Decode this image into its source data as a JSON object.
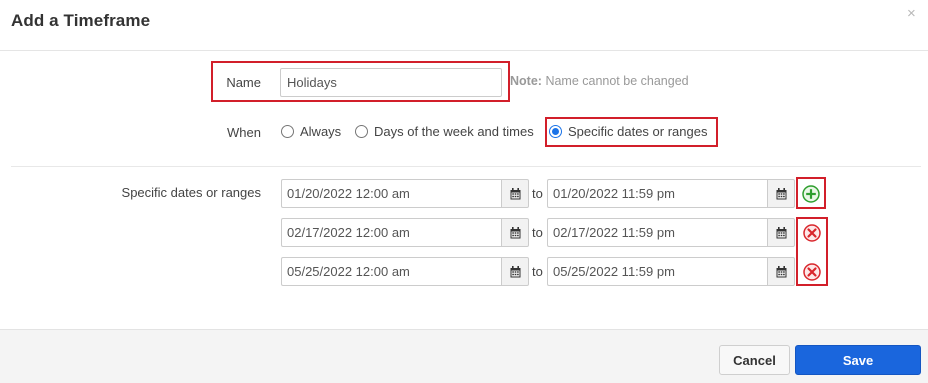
{
  "dialog": {
    "title": "Add a Timeframe",
    "close_symbol": "×"
  },
  "name": {
    "label": "Name",
    "value": "Holidays",
    "note_bold": "Note:",
    "note_text": "Name cannot be changed"
  },
  "when": {
    "label": "When",
    "options": [
      {
        "label": "Always",
        "selected": false
      },
      {
        "label": "Days of the week and times",
        "selected": false
      },
      {
        "label": "Specific dates or ranges",
        "selected": true
      }
    ]
  },
  "ranges": {
    "label": "Specific dates or ranges",
    "separator": "to",
    "rows": [
      {
        "start": "01/20/2022 12:00 am",
        "end": "01/20/2022 11:59 pm",
        "action": "add"
      },
      {
        "start": "02/17/2022 12:00 am",
        "end": "02/17/2022 11:59 pm",
        "action": "remove"
      },
      {
        "start": "05/25/2022 12:00 am",
        "end": "05/25/2022 11:59 pm",
        "action": "remove"
      }
    ]
  },
  "footer": {
    "cancel_label": "Cancel",
    "save_label": "Save"
  },
  "colors": {
    "highlight": "#d21f2a",
    "primary": "#1a66dd",
    "radio_selected": "#1a73e8",
    "add_icon": "#2e9e2e",
    "remove_icon": "#d9262c"
  },
  "icons": {
    "calendar": "calendar-icon",
    "add": "plus-circle-icon",
    "remove": "x-circle-icon",
    "close": "close-icon"
  }
}
